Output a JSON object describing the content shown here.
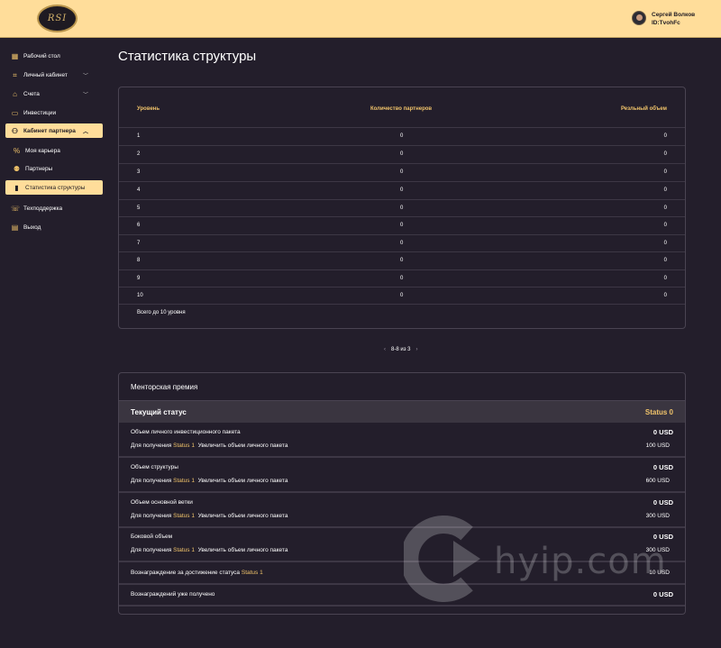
{
  "header": {
    "logo_text": "RSI",
    "user_name": "Сергей Волков",
    "user_id": "ID:TvohFc"
  },
  "sidebar": {
    "items": [
      {
        "label": "Рабочий стол",
        "icon": "dashboard-icon"
      },
      {
        "label": "Личный кабинет",
        "icon": "user-scan-icon"
      },
      {
        "label": "Счета",
        "icon": "bank-icon"
      },
      {
        "label": "Инвестиции",
        "icon": "monitor-icon"
      },
      {
        "label": "Кабинет партнера",
        "icon": "partner-icon"
      },
      {
        "label": "Моя карьера",
        "icon": "percent-icon"
      },
      {
        "label": "Партнеры",
        "icon": "users-icon"
      },
      {
        "label": "Статистика структуры",
        "icon": "bar-chart-icon"
      },
      {
        "label": "Техподдержка",
        "icon": "support-icon"
      },
      {
        "label": "Выход",
        "icon": "exit-icon"
      }
    ]
  },
  "page": {
    "title": "Статистика структуры"
  },
  "structure_table": {
    "headers": [
      "Уровень",
      "Количество партнеров",
      "Резльный объем"
    ],
    "rows": [
      [
        "1",
        "0",
        "0"
      ],
      [
        "2",
        "0",
        "0"
      ],
      [
        "3",
        "0",
        "0"
      ],
      [
        "4",
        "0",
        "0"
      ],
      [
        "5",
        "0",
        "0"
      ],
      [
        "6",
        "0",
        "0"
      ],
      [
        "7",
        "0",
        "0"
      ],
      [
        "8",
        "0",
        "0"
      ],
      [
        "9",
        "0",
        "0"
      ],
      [
        "10",
        "0",
        "0"
      ]
    ],
    "footnote": "Всего до 10 уровня"
  },
  "pagination": {
    "prev": "‹",
    "label": "8-8 из 3",
    "next": "›"
  },
  "mentor": {
    "title": "Менторская премия",
    "status_label": "Текущий статус",
    "status_value": "Status 0",
    "blocks": [
      {
        "title": "Объем личного инвестиционного пакета",
        "amount": "0 USD",
        "prefix": "Для получения",
        "status": "Status 1",
        "action": "Увеличить объем личного пакета",
        "target": "100 USD"
      },
      {
        "title": "Объем структуры",
        "amount": "0 USD",
        "prefix": "Для получения",
        "status": "Status 1",
        "action": "Увеличить объем личного пакета",
        "target": "600 USD"
      },
      {
        "title": "Объем основной ветки",
        "amount": "0 USD",
        "prefix": "Для получения",
        "status": "Status 1",
        "action": "Увеличить объем личного пакета",
        "target": "300 USD"
      },
      {
        "title": "Боковой объем",
        "amount": "0 USD",
        "prefix": "Для получения",
        "status": "Status 1",
        "action": "Увеличить объем личного пакета",
        "target": "300 USD"
      }
    ],
    "reward": {
      "label": "Вознаграждение за достижение статуса",
      "status": "Status 1",
      "amount": "10 USD"
    },
    "received": {
      "label": "Вознаграждений уже получено",
      "amount": "0 USD"
    }
  },
  "watermark": {
    "text": "hyip.com"
  },
  "colors": {
    "accent": "#ffdd9a",
    "gold": "#f0c36a",
    "background": "#231e2b"
  }
}
